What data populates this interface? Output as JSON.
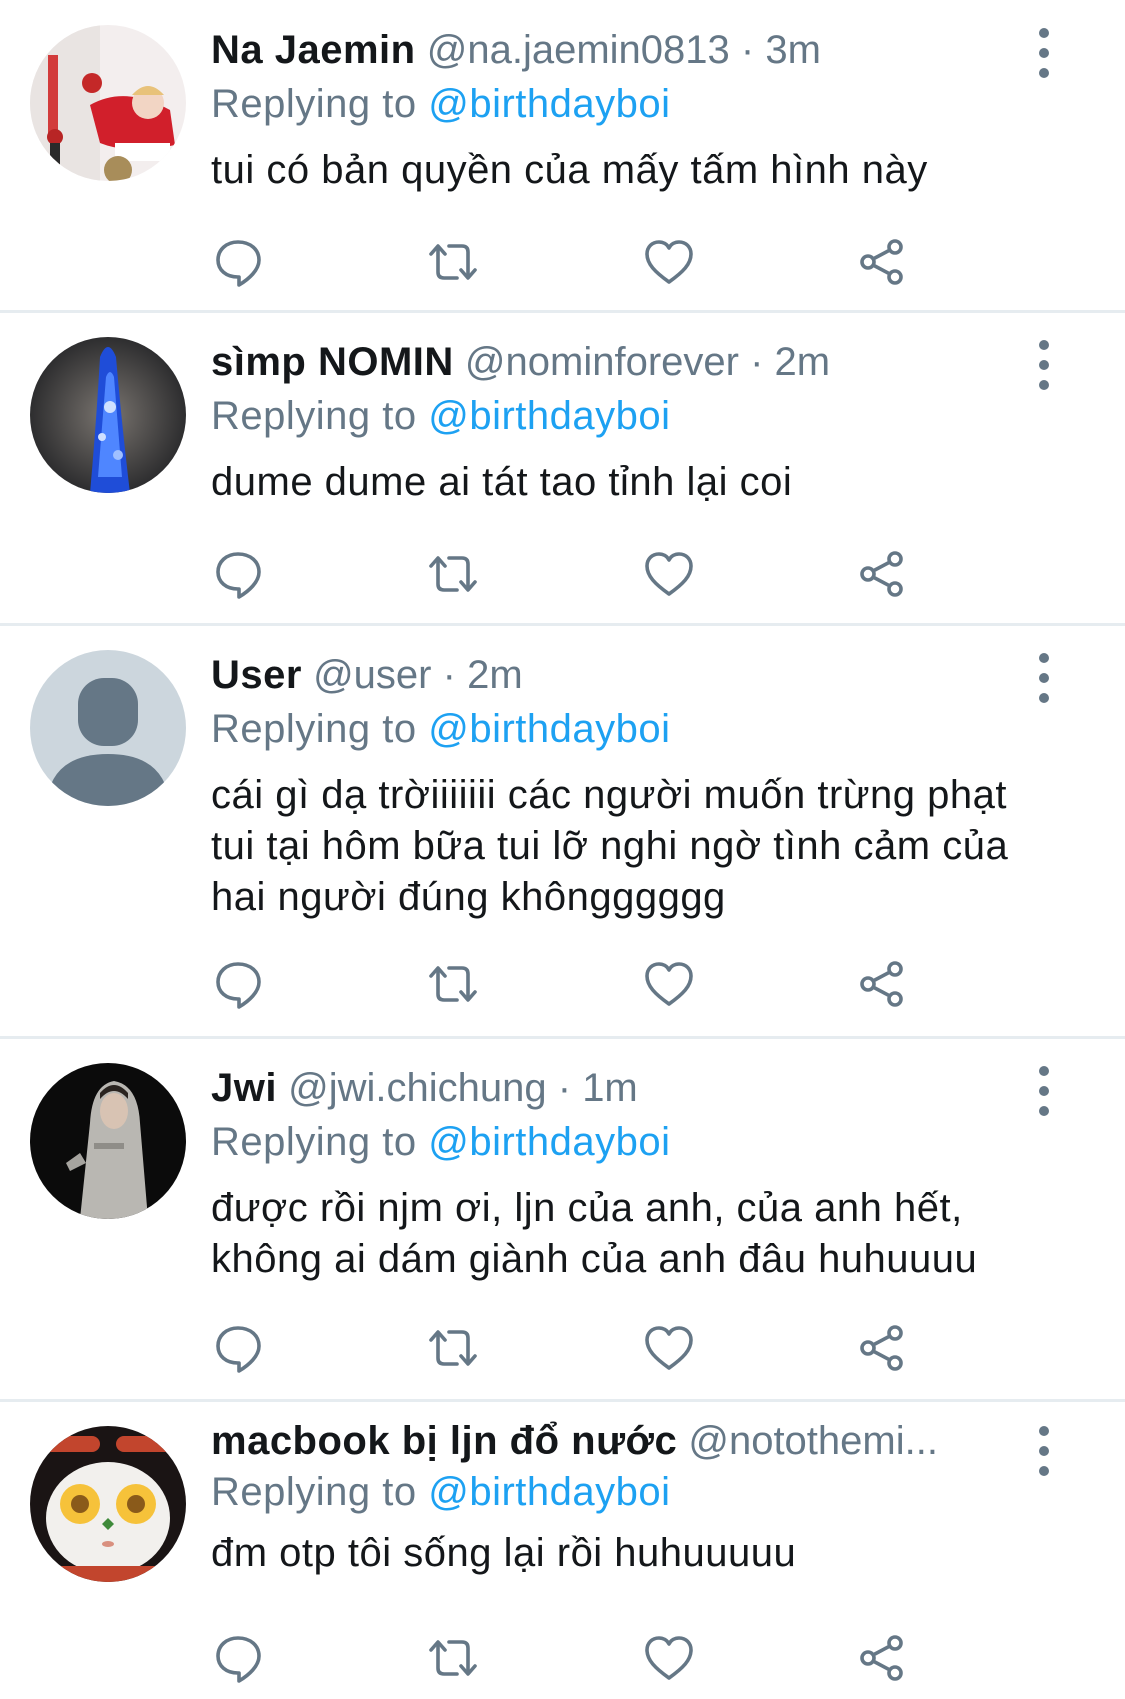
{
  "reply_prefix": "Replying to ",
  "reply_target": "@birthdayboi",
  "separator": "·",
  "tweets": [
    {
      "name": "Na Jaemin",
      "handle": "@na.jaemin0813",
      "time": "3m",
      "text": "tui có bản quyền của mấy tấm hình này",
      "avatar": "avatar-red-outfit"
    },
    {
      "name": "sìmp NOMIN",
      "handle": "@nominforever",
      "time": "2m",
      "text": "dume dume ai tát tao tỉnh lại coi",
      "avatar": "avatar-blue-light"
    },
    {
      "name": "User",
      "handle": "@user",
      "time": "2m",
      "text": "cái gì dạ trờiiiiiii các người muốn trừng phạt tui tại hôm bữa tui lỡ nghi ngờ tình cảm của hai người đúng khôngggggg",
      "avatar": "avatar-default"
    },
    {
      "name": "Jwi",
      "handle": "@jwi.chichung",
      "time": "1m",
      "text": "được rồi njm ơi, ljn của anh, của anh hết, không ai dám giành của anh đâu huhuuuu",
      "avatar": "avatar-hoodie-person"
    },
    {
      "name": "macbook bị ljn đổ nước",
      "handle": "@notothemi...",
      "time": "",
      "text": "đm otp tôi sống lại rồi huhuuuuu",
      "avatar": "avatar-egg-face"
    }
  ],
  "icons": {
    "reply": "reply-icon",
    "retweet": "retweet-icon",
    "like": "heart-icon",
    "share": "share-icon",
    "more": "more-vertical-icon"
  },
  "colors": {
    "text": "#14171a",
    "secondary": "#657786",
    "link": "#1da1f2",
    "divider": "#e6ecf0"
  }
}
